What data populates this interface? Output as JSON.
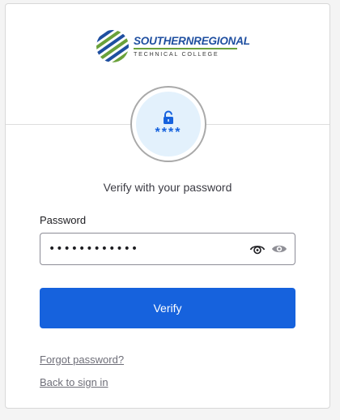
{
  "logo": {
    "name_part1": "SOUTHERN",
    "name_part2": "REGIONAL",
    "subtitle": "TECHNICAL COLLEGE",
    "colors": {
      "blue": "#1f4fa0",
      "green": "#6aa13a",
      "gray": "#3a3a3a"
    }
  },
  "factor": {
    "icon": "lock-icon",
    "mask_text": "****"
  },
  "heading": "Verify with your password",
  "password": {
    "label": "Password",
    "value": "••••••••••••",
    "toggle_icon": "eye-icon",
    "extension_icon": "eye-icon"
  },
  "verify_button": {
    "label": "Verify",
    "color": "#1662dd"
  },
  "links": {
    "forgot": "Forgot password?",
    "back": "Back to sign in"
  }
}
